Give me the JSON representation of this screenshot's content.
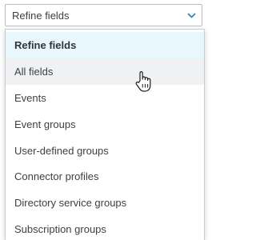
{
  "select": {
    "value": "Refine fields",
    "chevron_icon": "chevron-down-icon"
  },
  "dropdown": {
    "options": [
      {
        "label": "Refine fields",
        "state": "selected"
      },
      {
        "label": "All fields",
        "state": "hover"
      },
      {
        "label": "Events",
        "state": "normal"
      },
      {
        "label": "Event groups",
        "state": "normal"
      },
      {
        "label": "User-defined groups",
        "state": "normal"
      },
      {
        "label": "Connector profiles",
        "state": "normal"
      },
      {
        "label": "Directory service groups",
        "state": "normal"
      },
      {
        "label": "Subscription groups",
        "state": "normal"
      }
    ]
  },
  "cursor": {
    "icon": "hand-pointer-icon"
  },
  "colors": {
    "accent": "#1a8fc4",
    "selected_bg": "#e8f7fb",
    "hover_bg": "#f0f1f2",
    "border": "#b9bdc2",
    "text": "#3c4146"
  }
}
